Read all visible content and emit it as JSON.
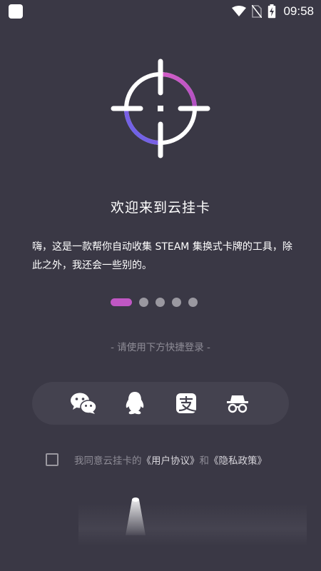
{
  "status_bar": {
    "time": "09:58",
    "icons": [
      "wifi-icon",
      "no-sim-icon",
      "battery-charging-icon"
    ]
  },
  "welcome": {
    "title": "欢迎来到云挂卡",
    "description": "嗨，这是一款帮你自动收集 STEAM 集换式卡牌的工具，除此之外，我还会一些别的。"
  },
  "carousel": {
    "page_count": 5,
    "active_index": 0
  },
  "login": {
    "hint": "- 请使用下方快捷登录 -",
    "methods": [
      {
        "name": "WeChat",
        "icon": "wechat-icon"
      },
      {
        "name": "QQ",
        "icon": "qq-penguin-icon"
      },
      {
        "name": "Alipay",
        "icon": "alipay-icon"
      },
      {
        "name": "Anonymous",
        "icon": "incognito-icon"
      }
    ]
  },
  "agreement": {
    "checked": false,
    "prefix": "我同意云挂卡的",
    "user_agreement": "《用户协议》",
    "conjunction": "和",
    "privacy_policy": "《隐私政策》"
  },
  "colors": {
    "background": "#3a3845",
    "accent_pink": "#c057c4",
    "accent_purple": "#7b5fe0",
    "muted_text": "#8e8c96"
  }
}
